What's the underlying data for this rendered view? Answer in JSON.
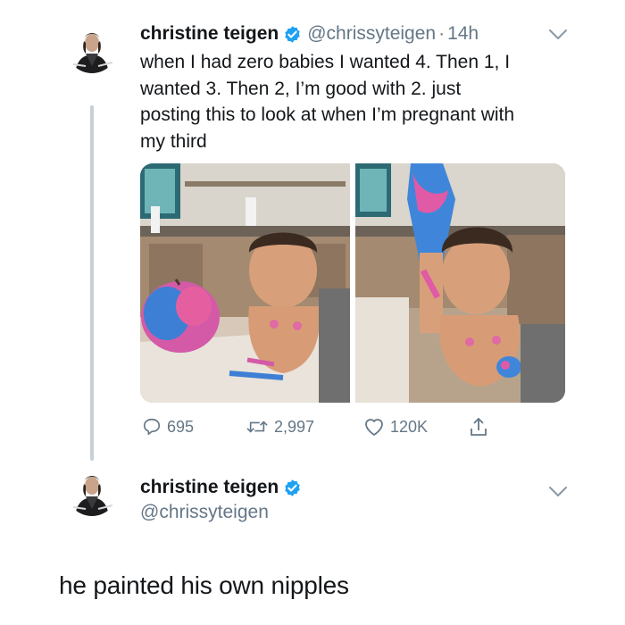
{
  "tweet1": {
    "author_name": "christine teigen",
    "handle": "@chrissyteigen",
    "separator": "·",
    "time": "14h",
    "text_lines": [
      "when I had zero babies I wanted 4. Then 1, I",
      "wanted 3. Then 2, I’m good with 2. just",
      "posting this to look at when I’m pregnant with",
      "my third"
    ],
    "actions": {
      "replies": "695",
      "retweets": "2,997",
      "likes": "120K"
    }
  },
  "tweet2": {
    "author_name": "christine teigen",
    "handle": "@chrissyteigen",
    "text": "he painted his own nipples"
  },
  "colors": {
    "verified_blue": "#1da1f2",
    "secondary_gray": "#657786",
    "thread_line": "#c7d0d8"
  },
  "icons": {
    "reply": "speech-bubble-icon",
    "retweet": "retweet-arrows-icon",
    "like": "heart-icon",
    "share": "upload-arrow-icon",
    "verified": "verified-badge-icon",
    "more": "chevron-down-icon"
  }
}
